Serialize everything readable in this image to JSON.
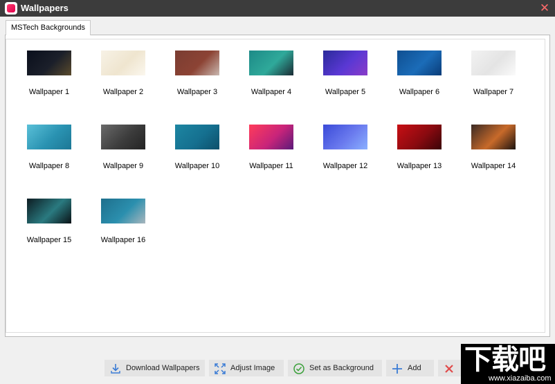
{
  "window": {
    "title": "Wallpapers",
    "close_icon": "close-icon"
  },
  "tabs": [
    {
      "label": "MSTech Backgrounds",
      "active": true
    }
  ],
  "wallpapers": [
    {
      "label": "Wallpaper 1",
      "colors": [
        "#0a0f1c",
        "#1b1f2a",
        "#5a4a2c"
      ]
    },
    {
      "label": "Wallpaper 2",
      "colors": [
        "#f7f2e6",
        "#efe5cf",
        "#fbf7ee"
      ]
    },
    {
      "label": "Wallpaper 3",
      "colors": [
        "#7a3d32",
        "#8c4334",
        "#c9b8b0"
      ]
    },
    {
      "label": "Wallpaper 4",
      "colors": [
        "#1d8a87",
        "#2fa99a",
        "#1b2a33"
      ]
    },
    {
      "label": "Wallpaper 5",
      "colors": [
        "#2a2a9a",
        "#5a38d4",
        "#8a3cc8"
      ]
    },
    {
      "label": "Wallpaper 6",
      "colors": [
        "#0f4f91",
        "#1b6cb8",
        "#0a3c78"
      ]
    },
    {
      "label": "Wallpaper 7",
      "colors": [
        "#f2f2f2",
        "#e4e4e4",
        "#fafafa"
      ]
    },
    {
      "label": "Wallpaper 8",
      "colors": [
        "#5ac0d8",
        "#2a93b2",
        "#1c7795"
      ]
    },
    {
      "label": "Wallpaper 9",
      "colors": [
        "#6a6a6a",
        "#3c3c3c",
        "#232323"
      ]
    },
    {
      "label": "Wallpaper 10",
      "colors": [
        "#1d86a2",
        "#157090",
        "#0d4f6a"
      ]
    },
    {
      "label": "Wallpaper 11",
      "colors": [
        "#ff3c5a",
        "#c8247a",
        "#5a1a7a"
      ]
    },
    {
      "label": "Wallpaper 12",
      "colors": [
        "#3a4ad8",
        "#6a7aee",
        "#8ab0ff"
      ]
    },
    {
      "label": "Wallpaper 13",
      "colors": [
        "#c80f14",
        "#8a0a10",
        "#3a0408"
      ]
    },
    {
      "label": "Wallpaper 14",
      "colors": [
        "#3a2a24",
        "#c86a2a",
        "#1c1410"
      ]
    },
    {
      "label": "Wallpaper 15",
      "colors": [
        "#0d1c22",
        "#2a7a80",
        "#0a1216"
      ]
    },
    {
      "label": "Wallpaper 16",
      "colors": [
        "#1e6f8c",
        "#2b8fae",
        "#a9b6bd"
      ]
    }
  ],
  "toolbar": {
    "download": {
      "label": "Download Wallpapers",
      "icon": "download-icon",
      "color": "#3a7bd5"
    },
    "adjust": {
      "label": "Adjust Image",
      "icon": "expand-arrows-icon",
      "color": "#3a7bd5"
    },
    "set_background": {
      "label": "Set as Background",
      "icon": "check-circle-icon",
      "color": "#3aa03a"
    },
    "add": {
      "label": "Add",
      "icon": "plus-icon",
      "color": "#3a7bd5"
    },
    "delete": {
      "label": "",
      "icon": "delete-x-icon",
      "color": "#e04a4a"
    }
  },
  "watermark": {
    "text": "下载吧",
    "url": "www.xiazaiba.com"
  }
}
